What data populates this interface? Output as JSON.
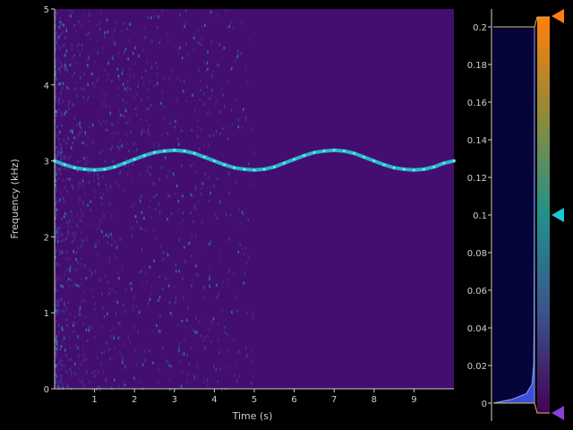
{
  "colors": {
    "background": "#000000",
    "plot_background": "#440e70",
    "line": "#2ab7c8",
    "axis": "#cfcfcf",
    "histogram_bg": "#05053a",
    "histogram_fill": "#3c4fd8",
    "handle_top": "#ff7f0e",
    "handle_mid": "#1ec8d2",
    "handle_bottom": "#8a3fd6"
  },
  "chart_data": [
    {
      "type": "heatmap",
      "title": "",
      "xlabel": "Time (s)",
      "ylabel": "Frequency (kHz)",
      "xlim": [
        0,
        10
      ],
      "ylim": [
        0,
        5
      ],
      "x_ticks": [
        1,
        2,
        3,
        4,
        5,
        6,
        7,
        8,
        9
      ],
      "y_ticks": [
        0,
        1,
        2,
        3,
        4,
        5
      ],
      "grid": false,
      "tone": {
        "name": "",
        "description_values": "frequency of dominant tone over time (kHz)",
        "x": [
          0.0,
          0.25,
          0.5,
          0.75,
          1.0,
          1.25,
          1.5,
          1.75,
          2.0,
          2.25,
          2.5,
          2.75,
          3.0,
          3.25,
          3.5,
          3.75,
          4.0,
          4.25,
          4.5,
          4.75,
          5.0,
          5.25,
          5.5,
          5.75,
          6.0,
          6.25,
          6.5,
          6.75,
          7.0,
          7.25,
          7.5,
          7.75,
          8.0,
          8.25,
          8.5,
          8.75,
          9.0,
          9.25,
          9.5,
          9.75,
          10.0
        ],
        "y": [
          3.0,
          2.95,
          2.91,
          2.89,
          2.88,
          2.89,
          2.92,
          2.97,
          3.02,
          3.07,
          3.11,
          3.13,
          3.14,
          3.13,
          3.1,
          3.05,
          3.0,
          2.95,
          2.91,
          2.89,
          2.88,
          2.89,
          2.92,
          2.97,
          3.02,
          3.07,
          3.11,
          3.13,
          3.14,
          3.13,
          3.1,
          3.05,
          3.0,
          2.95,
          2.91,
          2.89,
          2.88,
          2.89,
          2.92,
          2.97,
          3.0
        ]
      },
      "noise": "broadband noise strongest near t=0 and fading by t≈4 s"
    },
    {
      "type": "area",
      "title": "",
      "orientation": "vertical histogram with colorbar",
      "ylim": [
        0,
        0.21
      ],
      "y_ticks": [
        0,
        0.02,
        0.04,
        0.06,
        0.08,
        0.1,
        0.12,
        0.14,
        0.16,
        0.18,
        0.2
      ],
      "y_tick_labels": [
        "0",
        "0.02",
        "0.04",
        "0.06",
        "0.08",
        "0.1",
        "0.12",
        "0.14",
        "0.16",
        "0.18",
        "0.2"
      ],
      "levels": {
        "max": 0.2,
        "mid": 0.1,
        "min": 0.0
      },
      "histogram_values": [
        {
          "level": 0.0,
          "count": 1.0
        },
        {
          "level": 0.002,
          "count": 0.55
        },
        {
          "level": 0.005,
          "count": 0.2
        },
        {
          "level": 0.01,
          "count": 0.06
        },
        {
          "level": 0.02,
          "count": 0.02
        },
        {
          "level": 0.04,
          "count": 0.01
        },
        {
          "level": 0.1,
          "count": 0.004
        },
        {
          "level": 0.2,
          "count": 0.0
        }
      ]
    }
  ],
  "labels": {
    "x_axis_title": "Time (s)",
    "y_axis_title": "Frequency (kHz)"
  }
}
